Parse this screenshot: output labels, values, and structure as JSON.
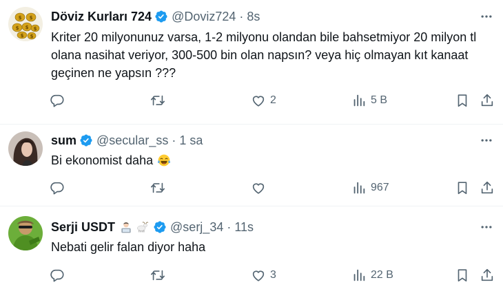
{
  "tweets": [
    {
      "name": "Döviz Kurları 724",
      "handle": "@Doviz724",
      "dot": "·",
      "time": "8s",
      "text": "Kriter 20 milyonunuz varsa, 1-2 milyonu olandan bile bahsetmiyor 20 milyon tl olana nasihat veriyor, 300-500 bin olan napsın? veya hiç olmayan kıt kanaat geçinen ne yapsın ???",
      "reply_count": "",
      "retweet_count": "",
      "like_count": "2",
      "view_count": "5 B"
    },
    {
      "name": "sum",
      "handle": "@secular_ss",
      "dot": "·",
      "time": "1 sa",
      "text": "Bi ekonomist daha",
      "text_emoji": "face-with-tears-of-joy",
      "reply_count": "",
      "retweet_count": "",
      "like_count": "",
      "view_count": "967"
    },
    {
      "name": "Serji USDT",
      "name_emojis": [
        "man-technologist-emoji",
        "goat-emoji"
      ],
      "handle": "@serj_34",
      "dot": "·",
      "time": "11s",
      "text": "Nebati gelir falan diyor haha",
      "reply_count": "",
      "retweet_count": "",
      "like_count": "3",
      "view_count": "22 B"
    }
  ],
  "colors": {
    "text": "#0f1419",
    "secondary": "#536471",
    "verified_blue": "#1d9bf0",
    "divider": "#eff3f4"
  },
  "icons": [
    "verified-badge-icon",
    "more-icon",
    "reply-icon",
    "retweet-icon",
    "like-icon",
    "views-icon",
    "bookmark-icon",
    "share-icon"
  ]
}
